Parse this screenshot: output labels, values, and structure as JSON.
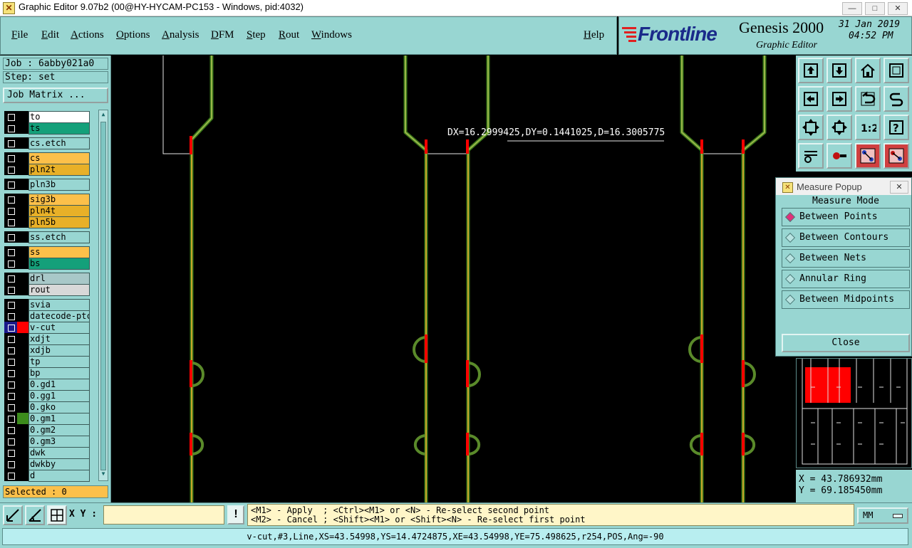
{
  "window": {
    "title": "Graphic Editor 9.07b2 (00@HY-HYCAM-PC153 - Windows, pid:4032)",
    "minimize": "—",
    "maximize": "□",
    "close": "✕"
  },
  "menu": [
    {
      "label": "File"
    },
    {
      "label": "Edit"
    },
    {
      "label": "Actions"
    },
    {
      "label": "Options"
    },
    {
      "label": "Analysis"
    },
    {
      "label": "DFM"
    },
    {
      "label": "Step"
    },
    {
      "label": "Rout"
    },
    {
      "label": "Windows"
    },
    {
      "label": "Help"
    }
  ],
  "brand": {
    "logo": "Frontline",
    "product": "Genesis 2000",
    "subtitle": "Graphic Editor",
    "date": "31 Jan 2019",
    "time": "04:52 PM"
  },
  "job": {
    "job_label": "Job : 6abby021a0",
    "step_label": "Step: set",
    "matrix_button": "Job Matrix ...",
    "selected": "Selected : 0"
  },
  "layers": [
    {
      "name": "to",
      "color": "#ffffff"
    },
    {
      "name": "ts",
      "color": "#14a07a"
    },
    {
      "name": "cs.etch",
      "color": "#98d6d2"
    },
    {
      "name": "cs",
      "color": "#fcc04a"
    },
    {
      "name": "pln2t",
      "color": "#e8b028"
    },
    {
      "name": "pln3b",
      "color": "#98d6d2"
    },
    {
      "name": "sig3b",
      "color": "#fcc04a"
    },
    {
      "name": "pln4t",
      "color": "#e8b028"
    },
    {
      "name": "pln5b",
      "color": "#e8b028"
    },
    {
      "name": "ss.etch",
      "color": "#98d6d2"
    },
    {
      "name": "ss",
      "color": "#fcc04a"
    },
    {
      "name": "bs",
      "color": "#14a07a"
    },
    {
      "name": "drl",
      "color": "#a8c8c8"
    },
    {
      "name": "rout",
      "color": "#d8d8d8"
    },
    {
      "name": "svia",
      "color": "#98d6d2"
    },
    {
      "name": "datecode-ptc",
      "color": "#98d6d2"
    },
    {
      "name": "v-cut",
      "color": "#98d6d2",
      "affected": true,
      "swatch": "#ff0000"
    },
    {
      "name": "xdjt",
      "color": "#98d6d2"
    },
    {
      "name": "xdjb",
      "color": "#98d6d2"
    },
    {
      "name": "tp",
      "color": "#98d6d2"
    },
    {
      "name": "bp",
      "color": "#98d6d2"
    },
    {
      "name": "0.gd1",
      "color": "#98d6d2"
    },
    {
      "name": "0.gg1",
      "color": "#98d6d2"
    },
    {
      "name": "0.gko",
      "color": "#98d6d2"
    },
    {
      "name": "0.gm1",
      "color": "#98d6d2",
      "swatch": "#3c8c1c"
    },
    {
      "name": "0.gm2",
      "color": "#98d6d2"
    },
    {
      "name": "0.gm3",
      "color": "#98d6d2"
    },
    {
      "name": "dwk",
      "color": "#98d6d2"
    },
    {
      "name": "dwkby",
      "color": "#98d6d2"
    },
    {
      "name": "d",
      "color": "#98d6d2"
    }
  ],
  "measure_readout": "DX=16.2999425,DY=0.1441025,D=16.3005775",
  "measure_popup": {
    "title": "Measure Popup",
    "header": "Measure Mode",
    "options": [
      {
        "label": "Between Points",
        "selected": true
      },
      {
        "label": "Between Contours",
        "selected": false
      },
      {
        "label": "Between Nets",
        "selected": false
      },
      {
        "label": "Annular Ring",
        "selected": false
      },
      {
        "label": "Between Midpoints",
        "selected": false
      }
    ],
    "close": "Close"
  },
  "coords": {
    "x": "X = 43.786932mm",
    "y": "Y = 69.185450mm"
  },
  "bottom": {
    "xy_label": "X Y :",
    "xy_value": "",
    "warn": "!",
    "hint1": "<M1> - Apply  ; <Ctrl><M1> or <N> - Re-select second point",
    "hint2": "<M2> - Cancel ; <Shift><M1> or <Shift><N> - Re-select first point",
    "units": "MM",
    "status": "v-cut,#3,Line,XS=43.54998,YS=14.4724875,XE=43.54998,YE=75.498625,r254,POS,Ang=-90"
  }
}
